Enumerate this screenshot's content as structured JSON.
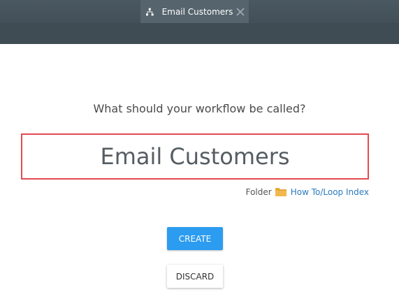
{
  "tab": {
    "title": "Email Customers",
    "icon": "workflow-icon",
    "close_icon": "close-icon"
  },
  "dialog": {
    "prompt": "What should your workflow be called?",
    "name_value": "Email Customers",
    "folder_label": "Folder",
    "folder_icon": "folder-icon",
    "folder_path": "How To/Loop Index",
    "create_label": "CREATE",
    "discard_label": "DISCARD"
  },
  "colors": {
    "accent": "#2c9cf0",
    "highlight_border": "#e34a52",
    "link": "#2b7bbf",
    "topbar": "#3f4c54",
    "tab_active": "#56646d",
    "folder": "#e8a838"
  }
}
